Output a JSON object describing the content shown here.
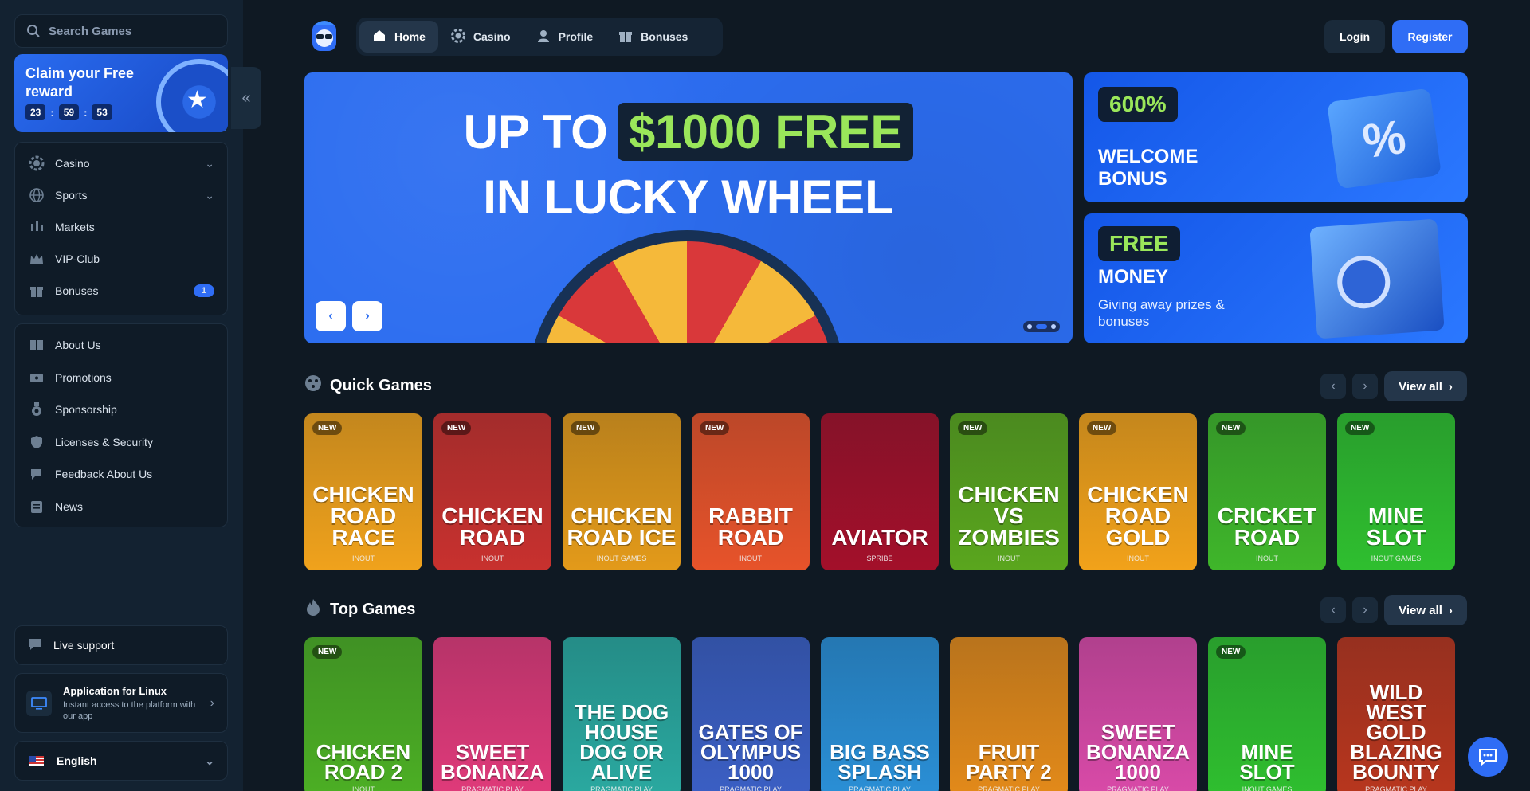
{
  "sidebar": {
    "search_placeholder": "Search Games",
    "promo": {
      "title": "Claim your Free reward",
      "hours": "23",
      "minutes": "59",
      "seconds": "53"
    },
    "nav_main": [
      {
        "label": "Casino",
        "icon": "casino-chip-icon",
        "expandable": true
      },
      {
        "label": "Sports",
        "icon": "globe-icon",
        "expandable": true
      },
      {
        "label": "Markets",
        "icon": "candlestick-icon"
      },
      {
        "label": "VIP-Club",
        "icon": "crown-icon"
      },
      {
        "label": "Bonuses",
        "icon": "gift-icon",
        "badge": "1"
      }
    ],
    "nav_info": [
      {
        "label": "About Us",
        "icon": "book-icon"
      },
      {
        "label": "Promotions",
        "icon": "ticket-icon"
      },
      {
        "label": "Sponsorship",
        "icon": "medal-icon"
      },
      {
        "label": "Licenses & Security",
        "icon": "shield-icon"
      },
      {
        "label": "Feedback About Us",
        "icon": "feedback-icon"
      },
      {
        "label": "News",
        "icon": "news-icon"
      }
    ],
    "live_support": "Live support",
    "app": {
      "title": "Application for Linux",
      "subtitle": "Instant access to the platform with our app"
    },
    "language": "English"
  },
  "topnav": {
    "tabs": [
      {
        "label": "Home",
        "icon": "home-icon",
        "active": true
      },
      {
        "label": "Casino",
        "icon": "casino-chip-icon"
      },
      {
        "label": "Profile",
        "icon": "user-icon"
      },
      {
        "label": "Bonuses",
        "icon": "gift-icon"
      }
    ],
    "login": "Login",
    "register": "Register"
  },
  "hero": {
    "line1_prefix": "UP TO",
    "line1_highlight": "$1000 FREE",
    "line2": "IN LUCKY WHEEL"
  },
  "side_banners": {
    "welcome": {
      "chip": "600%",
      "title": "WELCOME BONUS"
    },
    "money": {
      "chip": "FREE",
      "title": "MONEY",
      "subtitle": "Giving away prizes & bonuses"
    }
  },
  "quick_games": {
    "title": "Quick Games",
    "view_all": "View all",
    "games": [
      {
        "name": "Chicken Road Race",
        "provider": "InOut",
        "new": true,
        "color": "#f0a21c"
      },
      {
        "name": "Chicken Road",
        "provider": "InOut",
        "new": true,
        "color": "#c8312e"
      },
      {
        "name": "Chicken Road Ice",
        "provider": "InOut Games",
        "new": true,
        "color": "#e39a1a"
      },
      {
        "name": "Rabbit Road",
        "provider": "InOut",
        "new": true,
        "color": "#e7532a"
      },
      {
        "name": "Aviator",
        "provider": "Spribe",
        "new": false,
        "color": "#a3102a"
      },
      {
        "name": "Chicken vs Zombies",
        "provider": "InOut",
        "new": true,
        "color": "#5aa61e"
      },
      {
        "name": "Chicken Road Gold",
        "provider": "InOut",
        "new": true,
        "color": "#f2a21a"
      },
      {
        "name": "Cricket Road",
        "provider": "InOut",
        "new": true,
        "color": "#3fb62a"
      },
      {
        "name": "Mine Slot",
        "provider": "InOut Games",
        "new": true,
        "color": "#2fbf2f"
      }
    ]
  },
  "top_games": {
    "title": "Top Games",
    "view_all": "View all",
    "games": [
      {
        "name": "Chicken Road 2",
        "provider": "InOut",
        "new": true,
        "color": "#4caf24"
      },
      {
        "name": "Sweet Bonanza",
        "provider": "Pragmatic Play",
        "new": false,
        "color": "#e03a7a"
      },
      {
        "name": "The Dog House Dog or Alive",
        "provider": "Pragmatic Play",
        "new": false,
        "color": "#2aa9a0"
      },
      {
        "name": "Gates of Olympus 1000",
        "provider": "Pragmatic Play",
        "new": false,
        "color": "#3b5fc4"
      },
      {
        "name": "Big Bass Splash",
        "provider": "Pragmatic Play",
        "new": false,
        "color": "#2a8fd6"
      },
      {
        "name": "Fruit Party 2",
        "provider": "Pragmatic Play",
        "new": false,
        "color": "#e38a1a"
      },
      {
        "name": "Sweet Bonanza 1000",
        "provider": "Pragmatic Play",
        "new": false,
        "color": "#d94aa8"
      },
      {
        "name": "Mine Slot",
        "provider": "InOut Games",
        "new": true,
        "color": "#2fbf2f"
      },
      {
        "name": "Wild West Gold Blazing Bounty",
        "provider": "Pragmatic Play",
        "new": false,
        "color": "#b8361e"
      }
    ]
  },
  "new_badge": "NEW"
}
